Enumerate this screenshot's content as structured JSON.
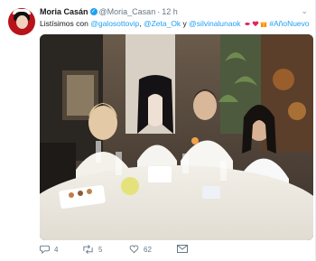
{
  "tweet": {
    "display_name": "Moria Casán",
    "handle": "@Moria_Casan",
    "separator": "·",
    "time": "12 h",
    "text_lead": "Listísimos con ",
    "mention_1": "@galosottovip",
    "mention_2": "@Zeta_Ok",
    "joiner": " y ",
    "mention_3": "@silvinalunaok",
    "hashtag": "#AñoNuevo",
    "emoji_icons": [
      "kiss-mark-icon",
      "heart-icon",
      "gift-icon"
    ]
  },
  "actions": {
    "reply_count": "4",
    "retweet_count": "5",
    "like_count": "62"
  },
  "colors": {
    "link": "#1da1f2",
    "text": "#14171a",
    "muted": "#657786",
    "avatar_bg": "#b8121b"
  }
}
